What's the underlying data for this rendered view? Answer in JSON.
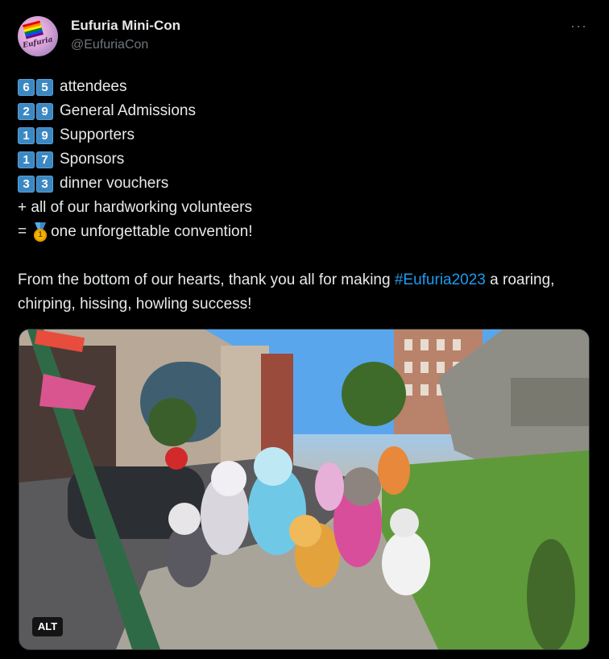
{
  "account": {
    "name": "Eufuria Mini-Con",
    "handle": "@EufuriaCon",
    "avatar_text": "Eufuria"
  },
  "more_label": "···",
  "stats": [
    {
      "digits": [
        "6",
        "5"
      ],
      "label": "attendees"
    },
    {
      "digits": [
        "2",
        "9"
      ],
      "label": "General Admissions"
    },
    {
      "digits": [
        "1",
        "9"
      ],
      "label": "Supporters"
    },
    {
      "digits": [
        "1",
        "7"
      ],
      "label": "Sponsors"
    },
    {
      "digits": [
        "3",
        "3"
      ],
      "label": "dinner vouchers"
    }
  ],
  "volunteers_line": "+ all of our hardworking volunteers",
  "result_line": {
    "prefix": "=",
    "medal_icon": "first-place-medal-icon",
    "text": "one unforgettable convention!"
  },
  "thanks": {
    "before": "From the bottom of our hearts, thank you all for making ",
    "hashtag": "#Eufuria2023",
    "after": " a roaring, chirping, hissing, howling success!"
  },
  "media": {
    "alt_badge": "ALT"
  },
  "colors": {
    "background": "#000000",
    "text": "#e7e9ea",
    "secondary": "#71767b",
    "link": "#1d9bf0",
    "keycap": "#3b88c3"
  }
}
